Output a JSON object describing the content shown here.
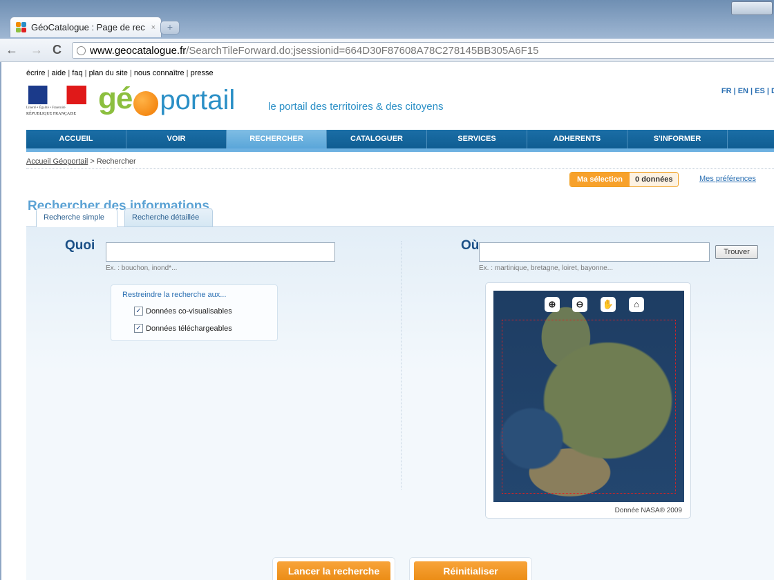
{
  "browser": {
    "tab_title": "GéoCatalogue : Page de rec",
    "tab_close": "×",
    "new_tab": "+",
    "url_host": "www.geocatalogue.fr",
    "url_path": "/SearchTileForward.do;jsessionid=664D30F87608A78C278145BB305A6F15",
    "back": "←",
    "forward": "→",
    "reload": "C"
  },
  "header": {
    "util_links": [
      "écrire",
      "aide",
      "faq",
      "plan du site",
      "nous connaître",
      "presse"
    ],
    "rf_motto": "Liberté • Égalité • Fraternité",
    "rf_name": "RÉPUBLIQUE FRANÇAISE",
    "logo_ge": "gé",
    "logo_portail": "portail",
    "tagline": "le portail des territoires & des citoyens",
    "lang_links": "FR | EN | ES | D"
  },
  "nav": {
    "items": [
      "ACCUEIL",
      "VOIR",
      "RECHERCHER",
      "CATALOGUER",
      "SERVICES",
      "ADHERENTS",
      "S'INFORMER"
    ],
    "active": "RECHERCHER"
  },
  "breadcrumb": {
    "home": "Accueil Géoportail",
    "sep": " > ",
    "current": "Rechercher"
  },
  "page": {
    "title": "Rechercher des informations",
    "selection_label": "Ma sélection",
    "selection_count": "0 données",
    "preferences": "Mes préférences"
  },
  "tabs": {
    "simple": "Recherche simple",
    "detailed": "Recherche détaillée"
  },
  "search": {
    "quoi_label": "Quoi",
    "quoi_value": "",
    "quoi_hint": "Ex. : bouchon, inond*...",
    "restrict_title": "Restreindre la recherche aux...",
    "cb1_label": "Données co-visualisables",
    "cb2_label": "Données téléchargeables",
    "ou_label": "Où",
    "ou_value": "",
    "ou_hint": "Ex. : martinique, bretagne, loiret, bayonne...",
    "trouver": "Trouver"
  },
  "map": {
    "credit": "Donnée NASA® 2009"
  },
  "actions": {
    "launch": "Lancer la recherche",
    "reset": "Réinitialiser"
  }
}
